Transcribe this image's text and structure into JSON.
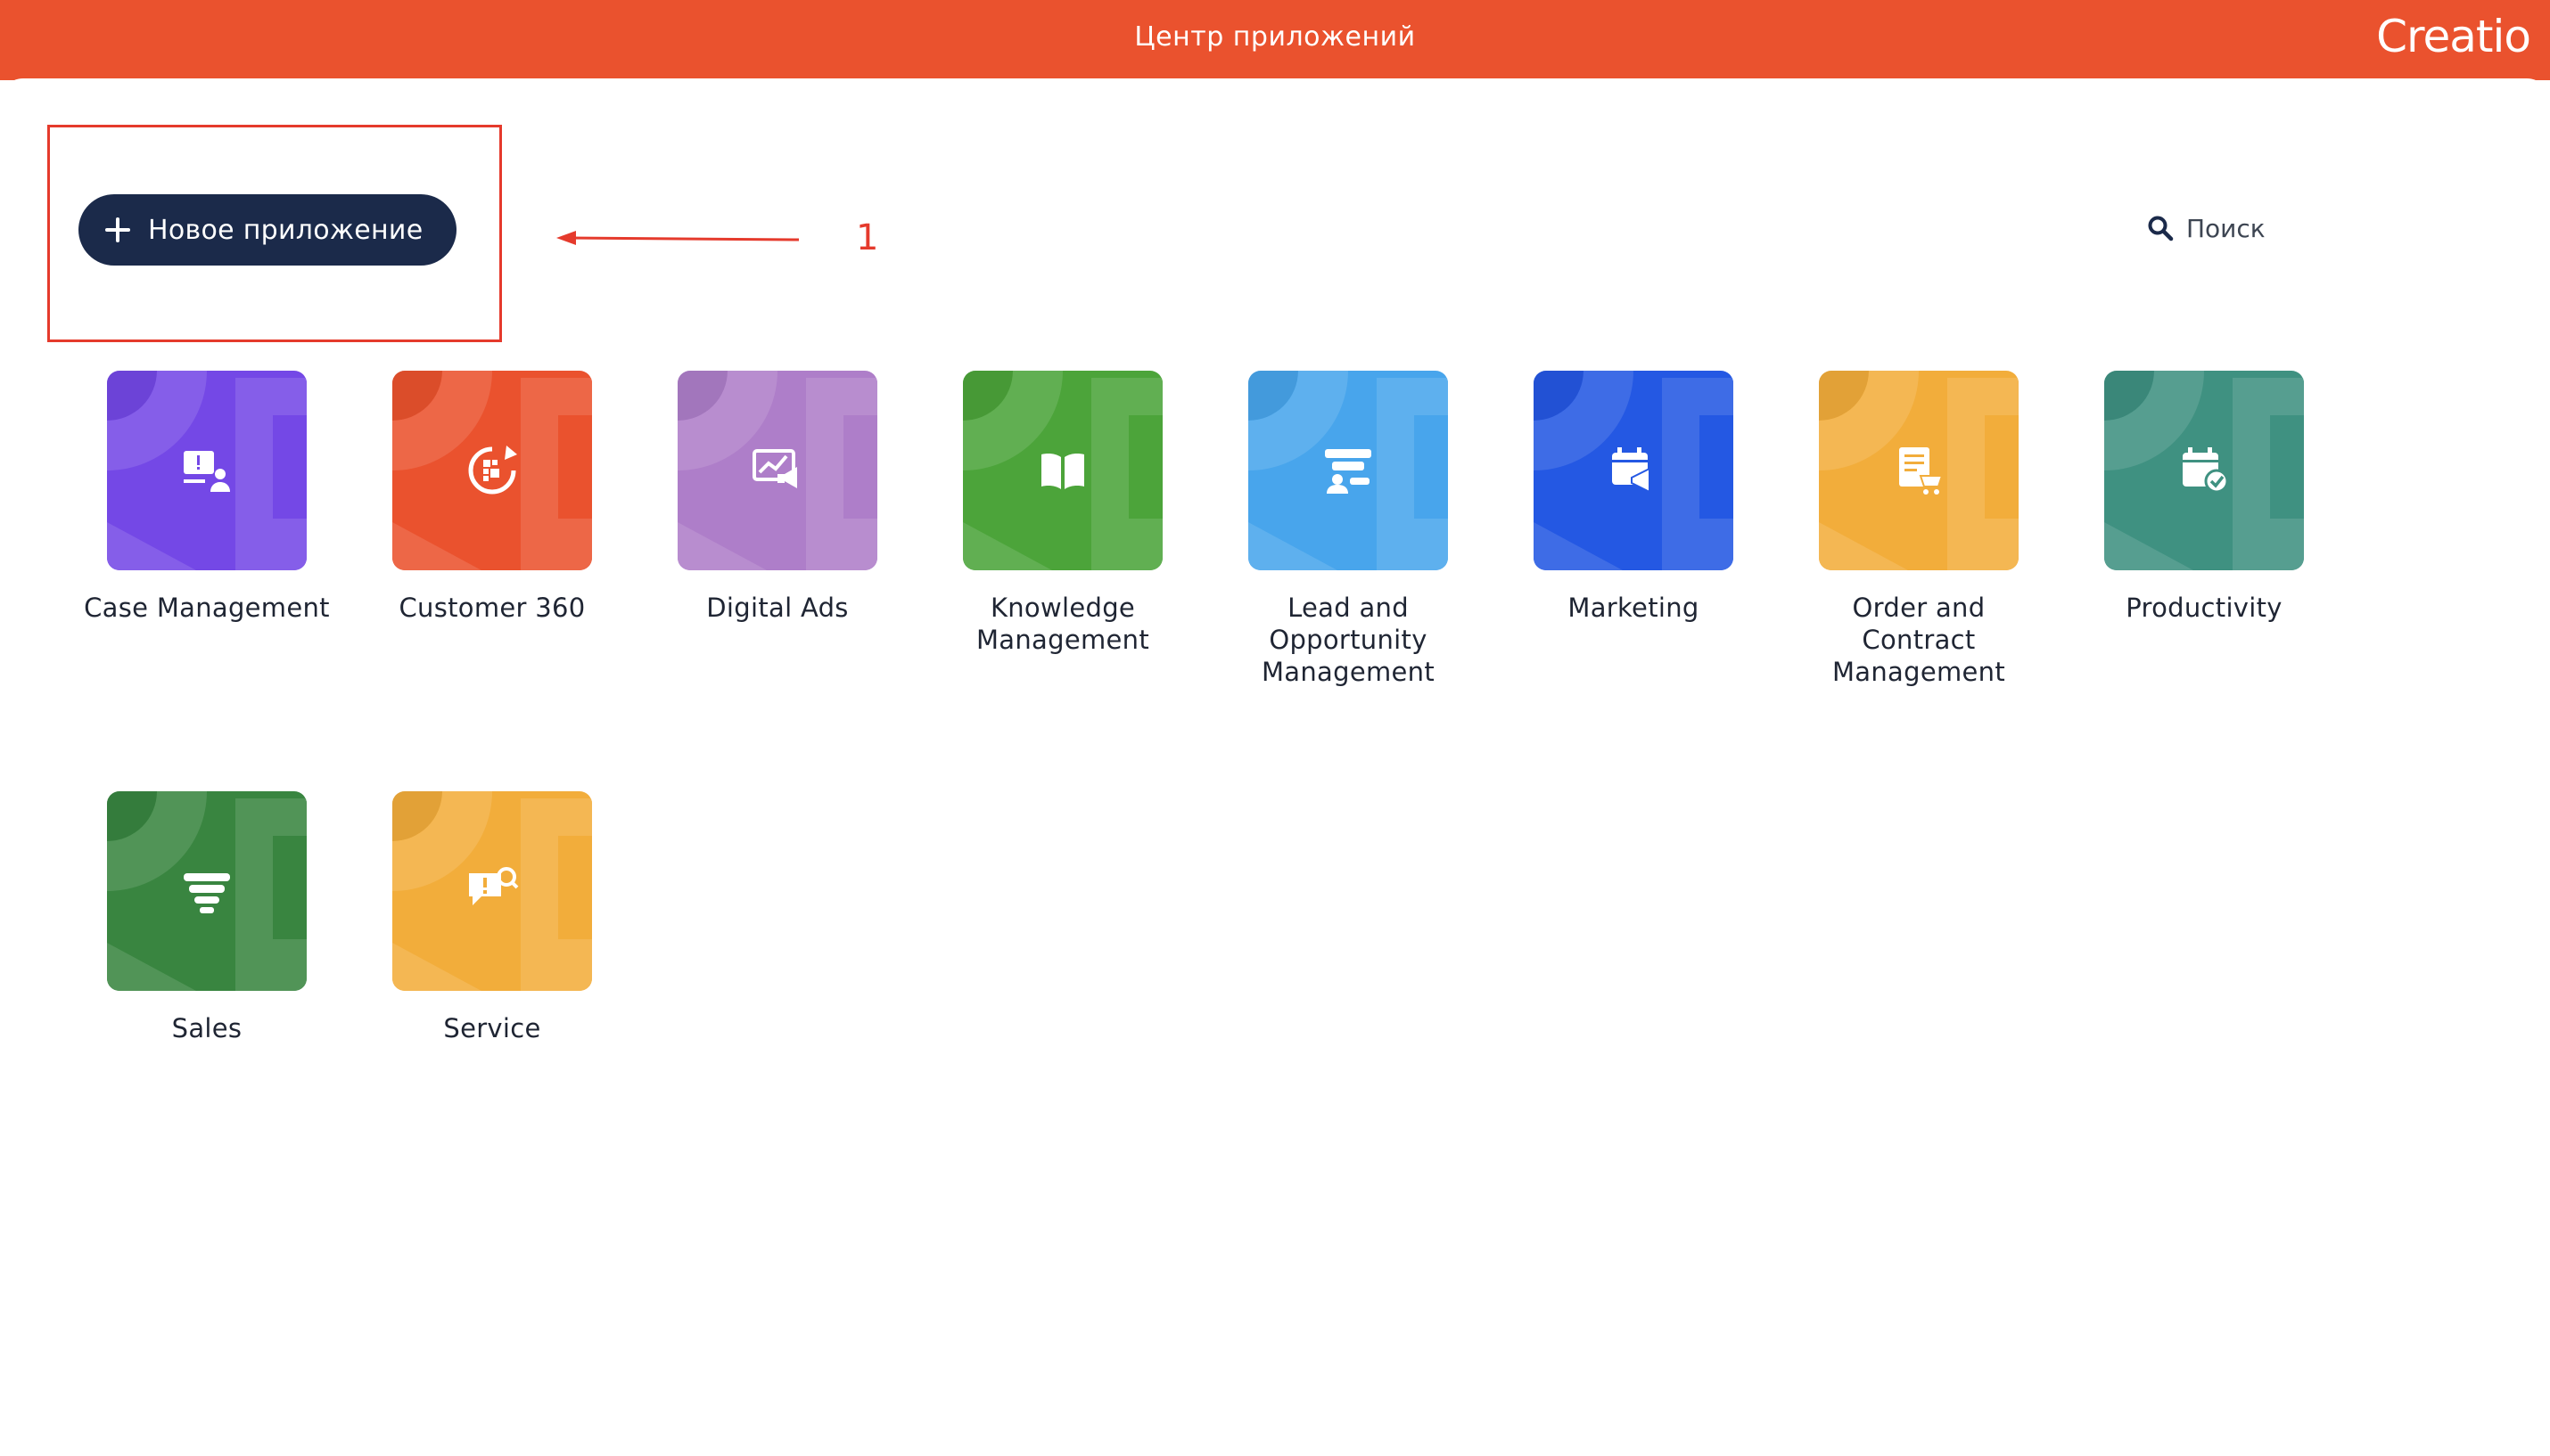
{
  "header": {
    "title": "Центр приложений",
    "logo_text": "Creatio",
    "background": "#ea522e"
  },
  "toolbar": {
    "new_app_label": "Новое приложение",
    "search_label": "Поиск",
    "button_color": "#1b2a4a"
  },
  "annotation": {
    "callout_number": "1",
    "color": "#e53a2c"
  },
  "apps": [
    {
      "label": "Case Management",
      "color": "#7448e6",
      "icon": "support-ticket-icon"
    },
    {
      "label": "Customer 360",
      "color": "#ea522e",
      "icon": "customer-cycle-icon"
    },
    {
      "label": "Digital Ads",
      "color": "#ae7ec9",
      "icon": "ads-monitor-icon"
    },
    {
      "label": "Knowledge Management",
      "color": "#4ca43a",
      "icon": "open-book-icon"
    },
    {
      "label": "Lead and Opportunity Management",
      "color": "#48a5ec",
      "icon": "lead-funnel-icon"
    },
    {
      "label": "Marketing",
      "color": "#2458e3",
      "icon": "calendar-megaphone-icon"
    },
    {
      "label": "Order and Contract Management",
      "color": "#f2ad3b",
      "icon": "order-cart-icon"
    },
    {
      "label": "Productivity",
      "color": "#3f9181",
      "icon": "calendar-check-icon"
    },
    {
      "label": "Sales",
      "color": "#398540",
      "icon": "sales-funnel-icon"
    },
    {
      "label": "Service",
      "color": "#f2ad3b",
      "icon": "service-chat-icon"
    }
  ]
}
